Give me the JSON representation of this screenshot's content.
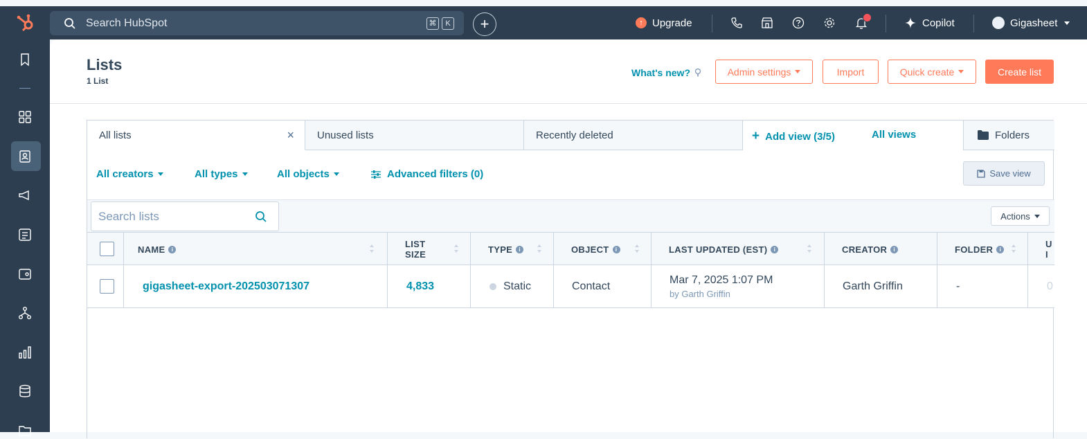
{
  "topbar": {
    "search_placeholder": "Search HubSpot",
    "shortcut_keys": [
      "⌘",
      "K"
    ],
    "upgrade_label": "Upgrade",
    "copilot_label": "Copilot",
    "account_label": "Gigasheet",
    "notification_badge": "•"
  },
  "header": {
    "title": "Lists",
    "count": "1 List",
    "whats_new": "What's new?",
    "admin_settings": "Admin settings",
    "import": "Import",
    "quick_create": "Quick create",
    "create_list": "Create list"
  },
  "tabs": [
    {
      "label": "All lists",
      "active": true
    },
    {
      "label": "Unused lists",
      "active": false
    },
    {
      "label": "Recently deleted",
      "active": false
    }
  ],
  "views": {
    "add_view": "Add view (3/5)",
    "all_views": "All views",
    "folders": "Folders"
  },
  "filters": {
    "creators": "All creators",
    "types": "All types",
    "objects": "All objects",
    "advanced": "Advanced filters (0)",
    "save_view": "Save view"
  },
  "toolbar": {
    "search_placeholder": "Search lists",
    "actions": "Actions"
  },
  "table": {
    "columns": {
      "name": "NAME",
      "list_size_1": "LIST",
      "list_size_2": "SIZE",
      "type": "TYPE",
      "object": "OBJECT",
      "last_updated": "LAST UPDATED (EST)",
      "creator": "CREATOR",
      "folder": "FOLDER",
      "used_in_1": "U",
      "used_in_2": "I"
    },
    "rows": [
      {
        "name": "gigasheet-export-202503071307",
        "list_size": "4,833",
        "type": "Static",
        "object": "Contact",
        "last_updated": "Mar 7, 2025 1:07 PM",
        "updated_by": "by Garth Griffin",
        "creator": "Garth Griffin",
        "folder": "-",
        "used_in": "0"
      }
    ]
  },
  "colors": {
    "nav_bg": "#2d3e50",
    "accent": "#ff7a59",
    "link": "#0091ae"
  }
}
